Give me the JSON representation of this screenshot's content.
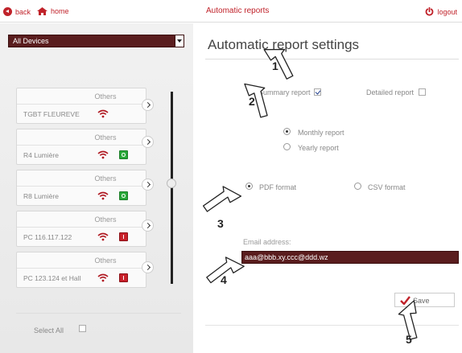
{
  "topbar": {
    "back_label": "back",
    "home_label": "home",
    "title": "Automatic reports",
    "logout_label": "logout"
  },
  "sidebar": {
    "device_filter": "All Devices",
    "devices": [
      {
        "category": "Others",
        "name": "TGBT FLEUREVE",
        "status": ""
      },
      {
        "category": "Others",
        "name": "R4 Lumière",
        "status": "O"
      },
      {
        "category": "Others",
        "name": "R8 Lumière",
        "status": "O"
      },
      {
        "category": "Others",
        "name": "PC 116.117.122",
        "status": "I"
      },
      {
        "category": "Others",
        "name": "PC 123.124 et Hall",
        "status": "I"
      }
    ],
    "select_all_label": "Select All"
  },
  "main": {
    "title": "Automatic report settings",
    "summary_report_label": "Summary report",
    "summary_report_checked": true,
    "detailed_report_label": "Detailed report",
    "detailed_report_checked": false,
    "period_options": [
      "Monthly report",
      "Yearly report"
    ],
    "period_selected": "Monthly report",
    "format_options": [
      "PDF format",
      "CSV format"
    ],
    "format_selected": "PDF format",
    "email_label": "Email address:",
    "email_value": "aaa@bbb.xy.ccc@ddd.wz",
    "save_label": "Save"
  },
  "callouts": [
    "1",
    "2",
    "3",
    "4",
    "5"
  ],
  "colors": {
    "accent": "#c0222a",
    "field_bg": "#5a1d1e",
    "status_on": "#28a838",
    "status_off": "#c8202a"
  }
}
